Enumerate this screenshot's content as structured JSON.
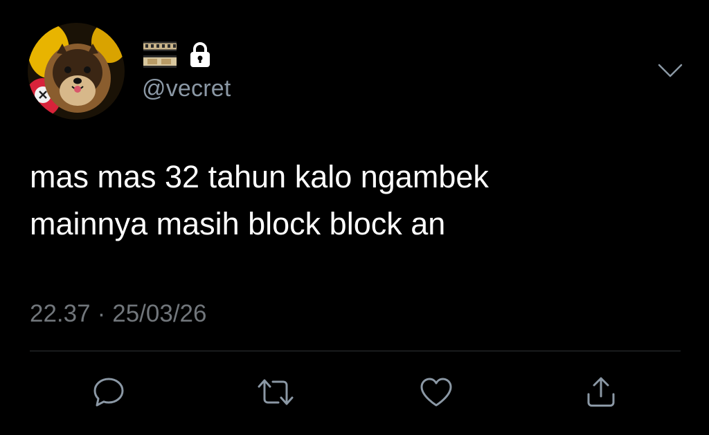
{
  "user": {
    "handle": "@vecret",
    "name_icons": [
      "film-strip-icon",
      "lock-icon"
    ],
    "avatar": "avatar"
  },
  "tweet": {
    "lines": [
      "mas mas 32 tahun kalo ngambek",
      "mainnya masih block block an"
    ],
    "time": "22.37",
    "separator": "·",
    "date": "25/03/26"
  },
  "actions": [
    "reply-icon",
    "retweet-icon",
    "like-icon",
    "share-icon"
  ],
  "menu_icon": "chevron-down-icon",
  "colors": {
    "background": "#000000",
    "text": "#ffffff",
    "secondary_text": "#8b98a5",
    "meta_text": "#71767b",
    "icon": "#8b98a5",
    "divider": "#2f3336"
  }
}
